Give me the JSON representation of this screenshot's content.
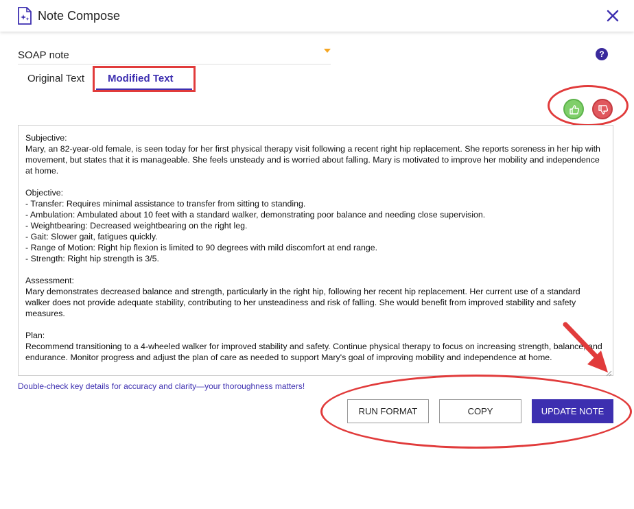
{
  "header": {
    "title": "Note Compose"
  },
  "template_select": {
    "value": "SOAP note"
  },
  "help": {
    "label": "?"
  },
  "tabs": [
    {
      "label": "Original Text"
    },
    {
      "label": "Modified Text"
    }
  ],
  "note_text": "Subjective:\nMary, an 82-year-old female, is seen today for her first physical therapy visit following a recent right hip replacement. She reports soreness in her hip with movement, but states that it is manageable. She feels unsteady and is worried about falling. Mary is motivated to improve her mobility and independence at home.\n\nObjective:\n- Transfer: Requires minimal assistance to transfer from sitting to standing.\n- Ambulation: Ambulated about 10 feet with a standard walker, demonstrating poor balance and needing close supervision.\n- Weightbearing: Decreased weightbearing on the right leg.\n- Gait: Slower gait, fatigues quickly.\n- Range of Motion: Right hip flexion is limited to 90 degrees with mild discomfort at end range.\n- Strength: Right hip strength is 3/5.\n\nAssessment:\nMary demonstrates decreased balance and strength, particularly in the right hip, following her recent hip replacement. Her current use of a standard walker does not provide adequate stability, contributing to her unsteadiness and risk of falling. She would benefit from improved stability and safety measures.\n\nPlan:\nRecommend transitioning to a 4-wheeled walker for improved stability and safety. Continue physical therapy to focus on increasing strength, balance, and endurance. Monitor progress and adjust the plan of care as needed to support Mary's goal of improving mobility and independence at home.",
  "hint": "Double-check key details for accuracy and clarity—your thoroughness matters!",
  "buttons": {
    "run_format": "RUN FORMAT",
    "copy": "COPY",
    "update_note": "UPDATE NOTE"
  },
  "icons": {
    "logo": "note-sparkle-icon",
    "close": "close-icon",
    "dropdown": "caret-down-icon",
    "thumbs_up": "thumbs-up-icon",
    "thumbs_down": "thumbs-down-icon"
  },
  "colors": {
    "accent": "#3d2fb0",
    "annotation": "#e13b3b",
    "thumbs_up": "#7fcf6a",
    "thumbs_down": "#e0585e",
    "caret": "#f5a623"
  }
}
